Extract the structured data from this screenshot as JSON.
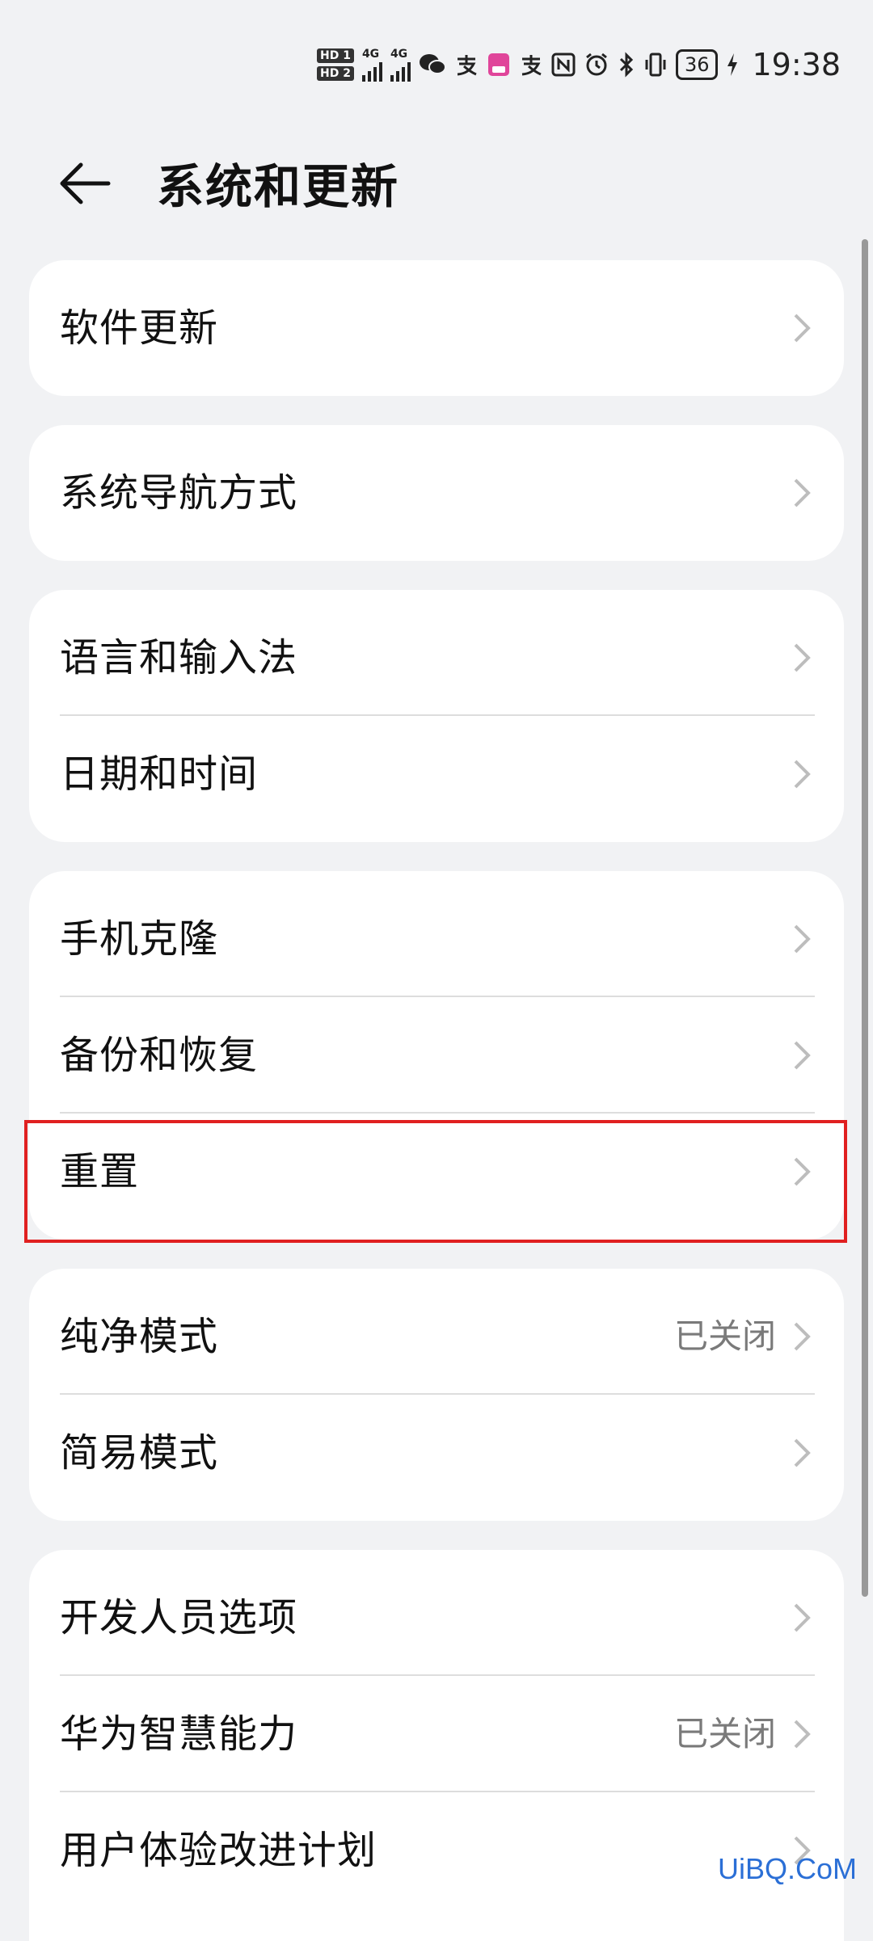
{
  "status_bar": {
    "hd1": "HD 1",
    "hd2": "HD 2",
    "net1": "4G",
    "net2": "4G",
    "battery": "36",
    "time": "19:38"
  },
  "header": {
    "title": "系统和更新"
  },
  "groups": [
    {
      "items": [
        {
          "label": "软件更新"
        }
      ]
    },
    {
      "items": [
        {
          "label": "系统导航方式"
        }
      ]
    },
    {
      "items": [
        {
          "label": "语言和输入法"
        },
        {
          "label": "日期和时间"
        }
      ]
    },
    {
      "items": [
        {
          "label": "手机克隆"
        },
        {
          "label": "备份和恢复"
        },
        {
          "label": "重置"
        }
      ]
    },
    {
      "items": [
        {
          "label": "纯净模式",
          "value": "已关闭"
        },
        {
          "label": "简易模式"
        }
      ]
    },
    {
      "items": [
        {
          "label": "开发人员选项"
        },
        {
          "label": "华为智慧能力",
          "value": "已关闭"
        },
        {
          "label": "用户体验改进计划"
        }
      ]
    }
  ],
  "watermark": "UiBQ.CoM",
  "colors": {
    "background": "#f1f2f4",
    "card": "#ffffff",
    "highlight": "#e02020"
  }
}
